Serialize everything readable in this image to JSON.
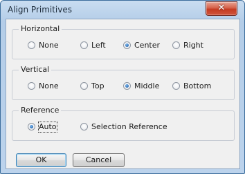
{
  "window": {
    "title": "Align Primitives",
    "close_glyph": "✕"
  },
  "horizontal": {
    "title": "Horizontal",
    "options": [
      {
        "label": "None",
        "checked": false
      },
      {
        "label": "Left",
        "checked": false
      },
      {
        "label": "Center",
        "checked": true
      },
      {
        "label": "Right",
        "checked": false
      }
    ]
  },
  "vertical": {
    "title": "Vertical",
    "options": [
      {
        "label": "None",
        "checked": false
      },
      {
        "label": "Top",
        "checked": false
      },
      {
        "label": "Middle",
        "checked": true
      },
      {
        "label": "Bottom",
        "checked": false
      }
    ]
  },
  "reference": {
    "title": "Reference",
    "options": [
      {
        "label": "Auto",
        "checked": true
      },
      {
        "label": "Selection Reference",
        "checked": false
      }
    ]
  },
  "buttons": {
    "ok": "OK",
    "cancel": "Cancel"
  },
  "colors": {
    "title_bar": "#b9d1ea",
    "close_button": "#c9452c",
    "radio_dot": "#1c5ea8",
    "dialog_bg": "#f0f0f0"
  }
}
